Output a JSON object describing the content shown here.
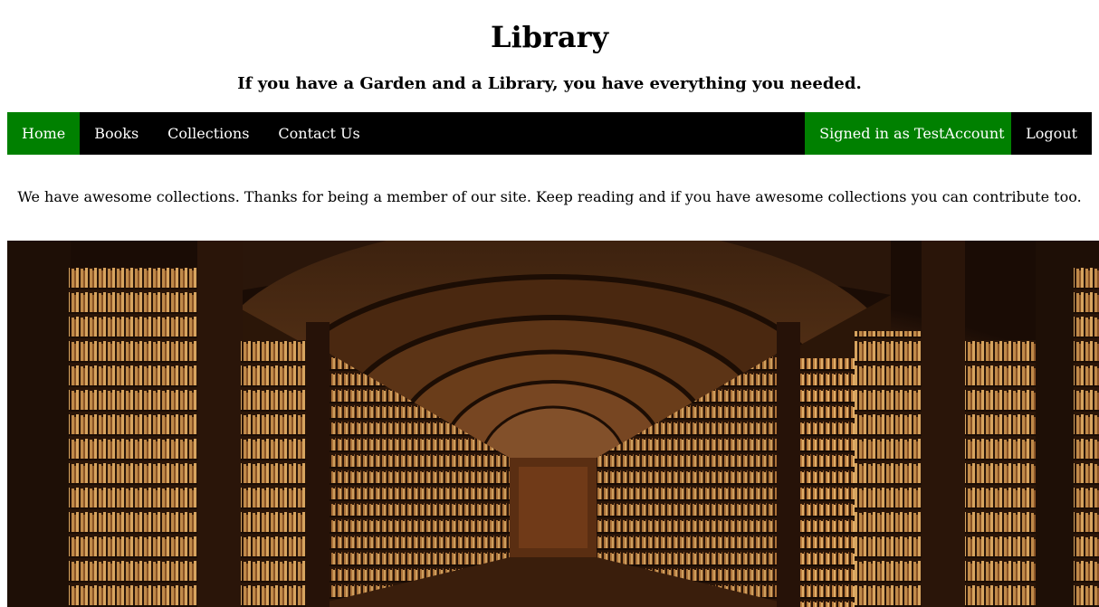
{
  "header": {
    "title": "Library",
    "tagline": "If you have a Garden and a Library, you have everything you needed."
  },
  "nav": {
    "left": [
      {
        "label": "Home",
        "active": true
      },
      {
        "label": "Books",
        "active": false
      },
      {
        "label": "Collections",
        "active": false
      },
      {
        "label": "Contact Us",
        "active": false
      }
    ],
    "signed_in": "Signed in as TestAccount",
    "logout": "Logout"
  },
  "main": {
    "intro": "We have awesome collections. Thanks for being a member of our site. Keep reading and if you have awesome collections you can contribute too."
  },
  "colors": {
    "nav_bg": "#000000",
    "active_bg": "#008000",
    "text": "#ffffff"
  },
  "icons": {
    "hero": "library-hall-photo"
  }
}
